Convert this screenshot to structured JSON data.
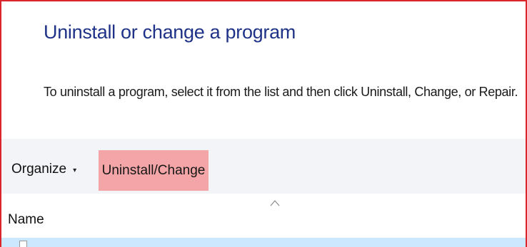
{
  "page": {
    "title": "Uninstall or change a program",
    "instructions": "To uninstall a program, select it from the list and then click Uninstall, Change, or Repair."
  },
  "toolbar": {
    "organize_label": "Organize",
    "organize_caret": "▾",
    "uninstall_label": "Uninstall/Change"
  },
  "list": {
    "columns": [
      {
        "label": "Name",
        "sort": "ascending"
      }
    ],
    "selected_row_icon": "program-icon"
  },
  "colors": {
    "title": "#1e3287",
    "highlight_border": "#d9262c",
    "toolbar_bg": "#f2f4f7",
    "uninstall_highlight": "#f3a5a7",
    "selected_row": "#cce8ff"
  }
}
